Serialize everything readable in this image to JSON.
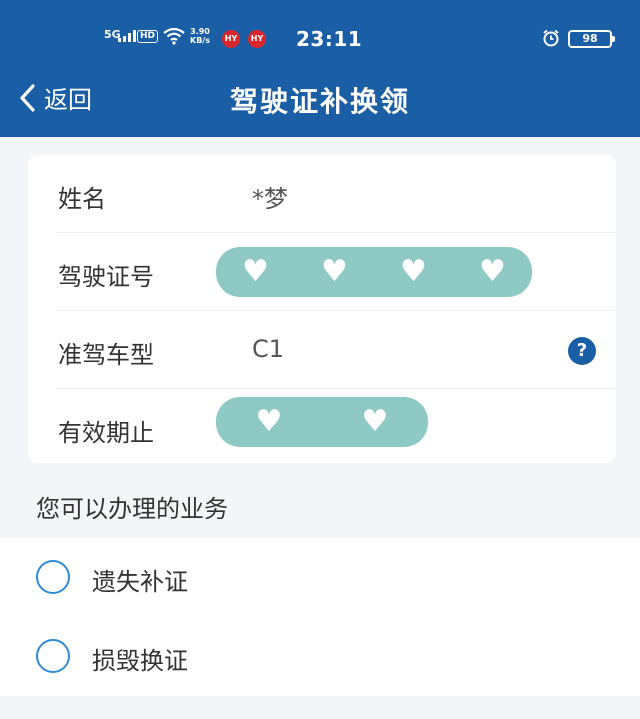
{
  "status_bar": {
    "network": "5G",
    "hd": "HD",
    "speed_value": "3.90",
    "speed_unit": "KB/s",
    "app1": "HY",
    "app2": "HY",
    "time": "23:11",
    "battery": "98",
    "icons": [
      "signal-icon",
      "wifi-icon",
      "alarm-icon",
      "battery-icon"
    ]
  },
  "nav": {
    "back_label": "返回",
    "title": "驾驶证补换领"
  },
  "info": {
    "rows": [
      {
        "label": "姓名",
        "value": "*梦"
      },
      {
        "label": "驾驶证号",
        "value": ""
      },
      {
        "label": "准驾车型",
        "value": "C1"
      },
      {
        "label": "有效期止",
        "value": ""
      }
    ],
    "help_symbol": "?"
  },
  "services": {
    "title": "您可以办理的业务",
    "options": [
      {
        "label": "遗失补证",
        "selected": false
      },
      {
        "label": "损毁换证",
        "selected": false
      }
    ]
  },
  "colors": {
    "header_bg": "#1a5ea6",
    "accent": "#2f8bd6",
    "redaction": "#8ec9c3",
    "page_bg": "#f3f5f8"
  }
}
